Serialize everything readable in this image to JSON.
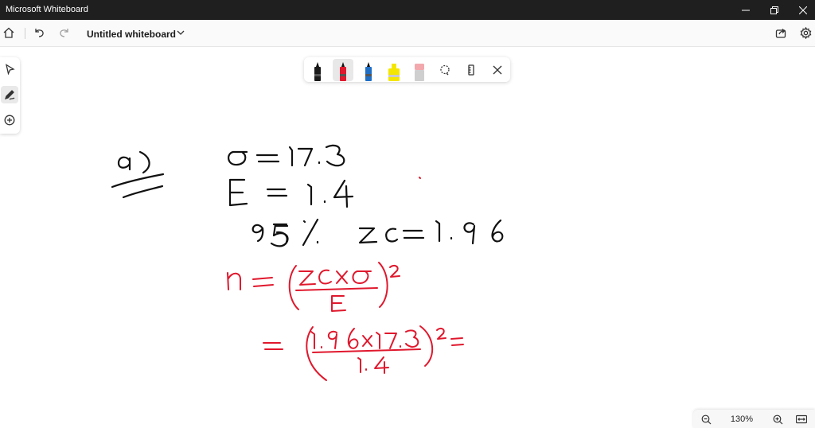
{
  "window": {
    "title": "Microsoft Whiteboard"
  },
  "toolbar": {
    "document_title": "Untitled whiteboard"
  },
  "ink_tools": [
    {
      "name": "pen",
      "color": "#1a1a1a"
    },
    {
      "name": "pen",
      "color": "#e0182d",
      "selected": true
    },
    {
      "name": "pen",
      "color": "#1f6fc5"
    },
    {
      "name": "highlighter",
      "color": "#f5e600"
    },
    {
      "name": "eraser",
      "color": "#f2a8ad"
    }
  ],
  "zoom": {
    "level": "130%"
  },
  "colors": {
    "ink_black": "#111111",
    "ink_red": "#e0182d",
    "titlebar": "#1f1f1f"
  },
  "handwriting": {
    "black_lines": [
      "a)",
      "σ=17.3",
      "E = 1.4",
      "95% zc = 1.96"
    ],
    "red_lines": [
      "n = (zc × σ / E)²",
      "= (1.96 × 17.3 / 1.4)² ="
    ]
  }
}
